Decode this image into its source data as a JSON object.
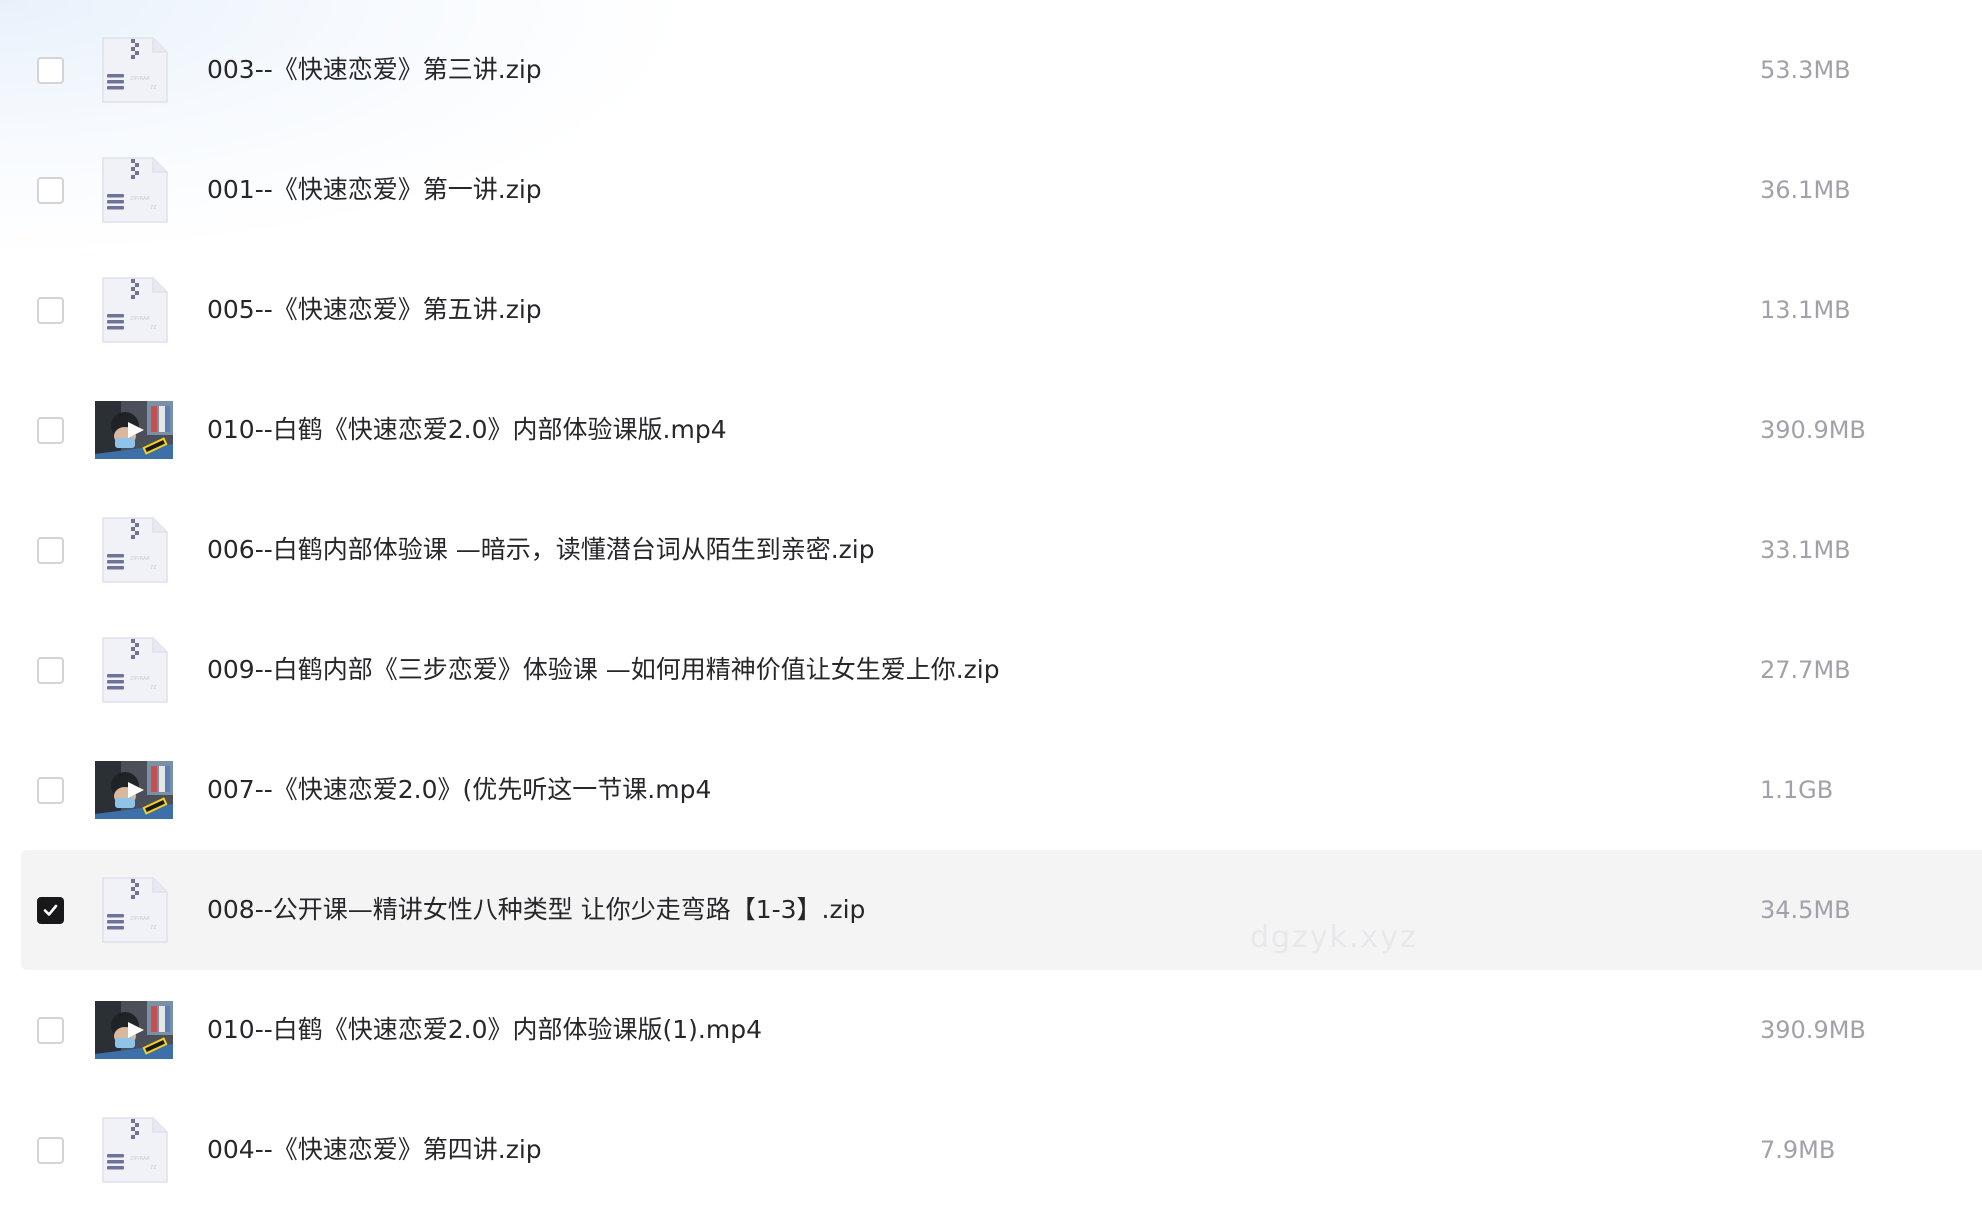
{
  "files": [
    {
      "name": "003--《快速恋爱》第三讲.zip",
      "size": "53.3MB",
      "type": "zip",
      "checked": false
    },
    {
      "name": "001--《快速恋爱》第一讲.zip",
      "size": "36.1MB",
      "type": "zip",
      "checked": false
    },
    {
      "name": "005--《快速恋爱》第五讲.zip",
      "size": "13.1MB",
      "type": "zip",
      "checked": false
    },
    {
      "name": "010--白鹤《快速恋爱2.0》内部体验课版.mp4",
      "size": "390.9MB",
      "type": "video",
      "checked": false
    },
    {
      "name": "006--白鹤内部体验课 —暗示，读懂潜台词从陌生到亲密.zip",
      "size": "33.1MB",
      "type": "zip",
      "checked": false
    },
    {
      "name": "009--白鹤内部《三步恋爱》体验课 —如何用精神价值让女生爱上你.zip",
      "size": "27.7MB",
      "type": "zip",
      "checked": false
    },
    {
      "name": "007--《快速恋爱2.0》(优先听这一节课.mp4",
      "size": "1.1GB",
      "type": "video",
      "checked": false
    },
    {
      "name": "008--公开课—精讲女性八种类型 让你少走弯路【1-3】.zip",
      "size": "34.5MB",
      "type": "zip",
      "checked": true
    },
    {
      "name": "010--白鹤《快速恋爱2.0》内部体验课版(1).mp4",
      "size": "390.9MB",
      "type": "video",
      "checked": false
    },
    {
      "name": "004--《快速恋爱》第四讲.zip",
      "size": "7.9MB",
      "type": "zip",
      "checked": false
    }
  ],
  "watermark": "dgzyk.xyz",
  "colors": {
    "selected_row_bg": "#f4f4f5",
    "checkbox_checked": "#18181b",
    "name_text": "#27272a",
    "size_text": "#a1a1aa"
  }
}
